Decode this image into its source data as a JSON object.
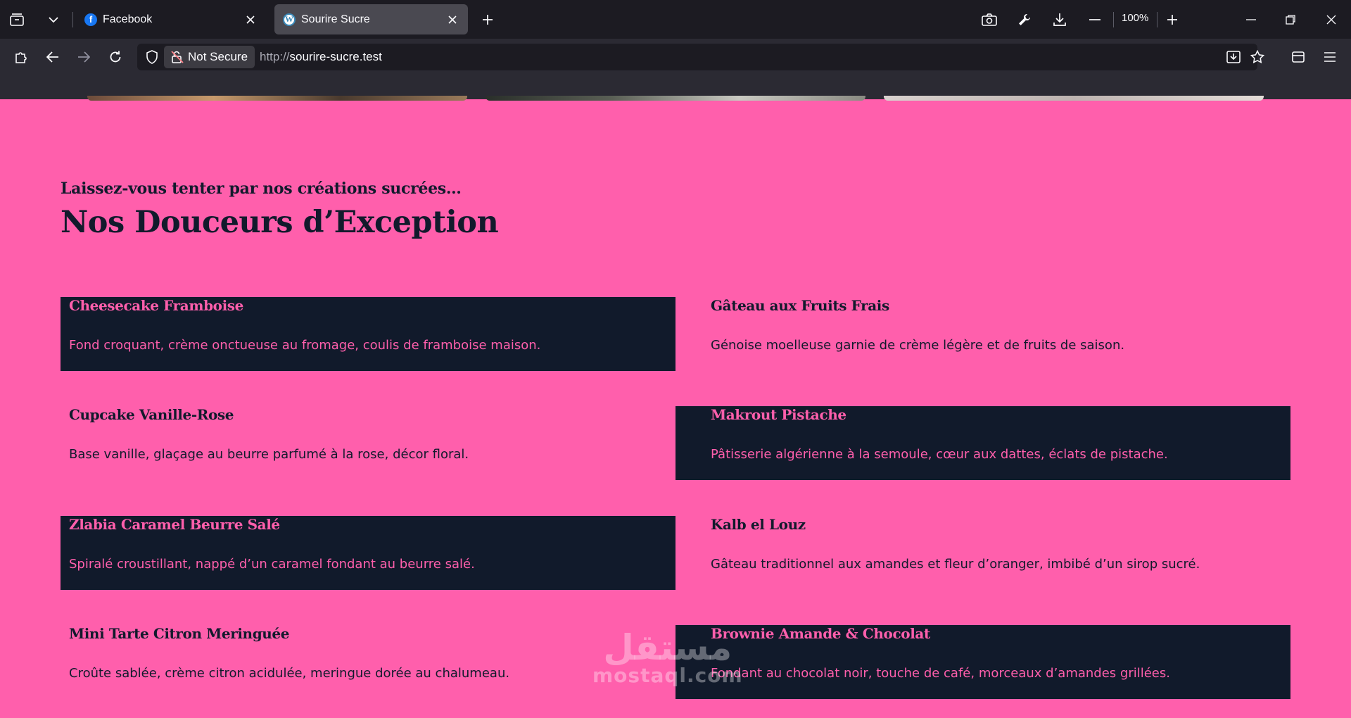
{
  "browser": {
    "tabs": [
      {
        "title": "Facebook",
        "favicon": "facebook-icon",
        "active": false
      },
      {
        "title": "Sourire Sucre",
        "favicon": "wordpress-icon",
        "active": true
      }
    ],
    "zoom": "100%",
    "security_label": "Not Secure",
    "url_protocol": "http://",
    "url_host": "sourire-sucre.test"
  },
  "section": {
    "kicker": "Laissez-vous tenter par nos créations sucrées…",
    "title": "Nos Douceurs d’Exception"
  },
  "products": [
    {
      "name": "Cheesecake Framboise",
      "description": "Fond croquant, crème onctueuse au fromage, coulis de framboise maison.",
      "style": "dark"
    },
    {
      "name": "Gâteau aux Fruits Frais",
      "description": "Génoise moelleuse garnie de crème légère et de fruits de saison.",
      "style": "light"
    },
    {
      "name": "Cupcake Vanille-Rose",
      "description": "Base vanille, glaçage au beurre parfumé à la rose, décor floral.",
      "style": "light"
    },
    {
      "name": "Makrout Pistache",
      "description": "Pâtisserie algérienne à la semoule, cœur aux dattes, éclats de pistache.",
      "style": "dark"
    },
    {
      "name": "Zlabia Caramel Beurre Salé",
      "description": "Spiralé croustillant, nappé d’un caramel fondant au beurre salé.",
      "style": "dark"
    },
    {
      "name": "Kalb el Louz",
      "description": "Gâteau traditionnel aux amandes et fleur d’oranger, imbibé d’un sirop sucré.",
      "style": "light"
    },
    {
      "name": "Mini Tarte Citron Meringuée",
      "description": "Croûte sablée, crème citron acidulée, meringue dorée au chalumeau.",
      "style": "light"
    },
    {
      "name": "Brownie Amande & Chocolat",
      "description": "Fondant au chocolat noir, touche de café, morceaux d’amandes grillées.",
      "style": "dark"
    }
  ],
  "watermark": {
    "arabic": "مستقل",
    "latin": "mostaql.com"
  },
  "colors": {
    "page_bg": "#ff5fac",
    "card_dark": "#111a2b",
    "text_dark": "#121a2c",
    "chrome_tabbar": "#1c1b22",
    "chrome_nav": "#2b2a33"
  }
}
